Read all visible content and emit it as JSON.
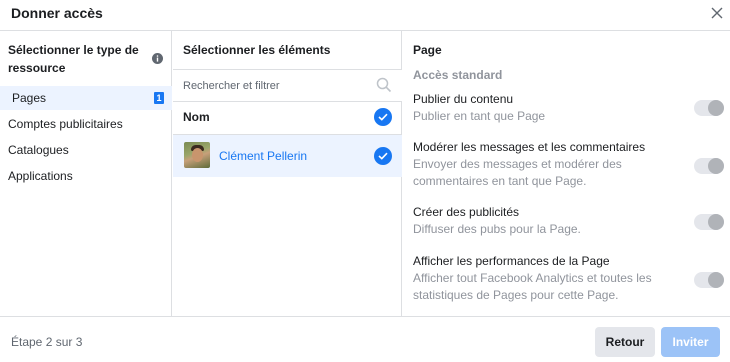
{
  "dialog": {
    "title": "Donner accès",
    "step_text": "Étape 2 sur 3",
    "back_label": "Retour",
    "invite_label": "Inviter"
  },
  "resource_types": {
    "heading": "Sélectionner le type de ressource",
    "items": [
      {
        "label": "Pages",
        "badge": "1",
        "selected": true
      },
      {
        "label": "Comptes publicitaires"
      },
      {
        "label": "Catalogues"
      },
      {
        "label": "Applications"
      }
    ]
  },
  "elements": {
    "heading": "Sélectionner les éléments",
    "search_placeholder": "Rechercher et filtrer",
    "column_label": "Nom",
    "rows": [
      {
        "name": "Clément Pellerin",
        "checked": true
      }
    ]
  },
  "permissions": {
    "heading": "Page",
    "section": "Accès standard",
    "items": [
      {
        "title": "Publier du contenu",
        "description": "Publier en tant que Page",
        "enabled": false
      },
      {
        "title": "Modérer les messages et les commentaires",
        "description": "Envoyer des messages et modérer des commentaires en tant que Page.",
        "enabled": false
      },
      {
        "title": "Créer des publicités",
        "description": "Diffuser des pubs pour la Page.",
        "enabled": false
      },
      {
        "title": "Afficher les performances de la Page",
        "description": "Afficher tout Facebook Analytics et toutes les statistiques de Pages pour cette Page.",
        "enabled": false
      }
    ]
  },
  "colors": {
    "accent": "#1877f2",
    "selected_bg": "#ecf3ff",
    "muted_text": "#90949c",
    "invite_disabled": "#9cc3f7"
  },
  "icons": {
    "close": "close-icon",
    "info": "info-icon",
    "search": "search-icon",
    "check": "check-icon"
  }
}
